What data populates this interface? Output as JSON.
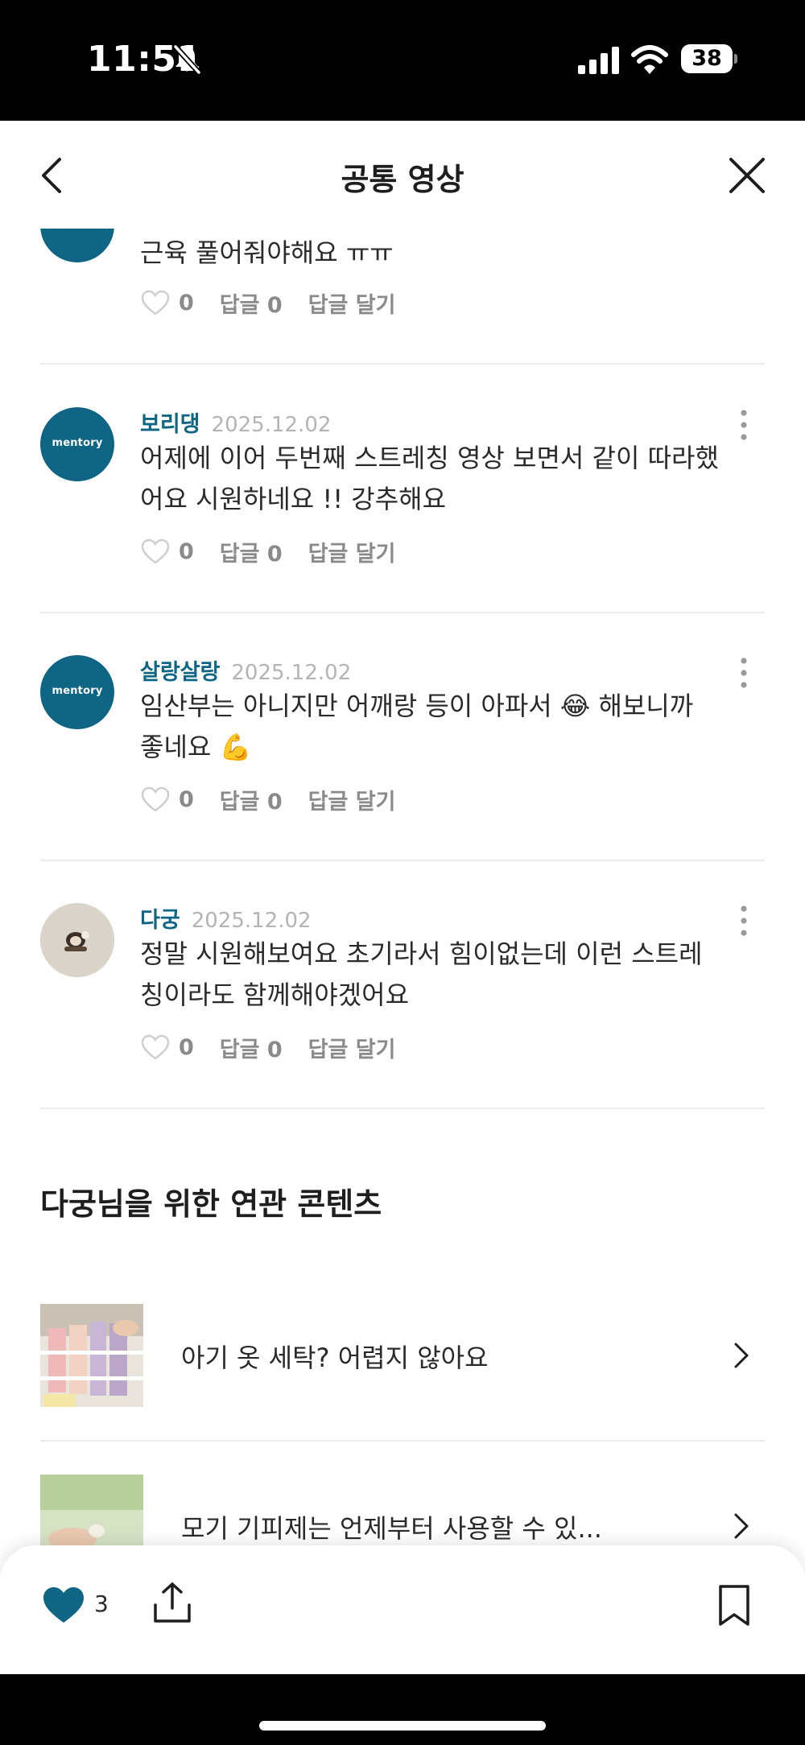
{
  "status_bar": {
    "time": "11:51",
    "battery": "38"
  },
  "header": {
    "title": "공통 영상"
  },
  "comments": [
    {
      "name": "",
      "date": "",
      "text": "근육 풀어줘야해요 ㅠㅠ",
      "likes": "0",
      "replies": "답글 0",
      "reply_label": "답글 달기"
    },
    {
      "name": "보리댕",
      "date": "2025.12.02",
      "text": "어제에 이어 두번째 스트레칭 영상 보면서 같이 따라했어요 시원하네요 !! 강추해요",
      "likes": "0",
      "replies": "답글 0",
      "reply_label": "답글 달기",
      "avatar_text": "mentory"
    },
    {
      "name": "살랑살랑",
      "date": "2025.12.02",
      "text": "임산부는 아니지만 어깨랑 등이 아파서 😂 해보니까 좋네요 💪",
      "likes": "0",
      "replies": "답글 0",
      "reply_label": "답글 달기",
      "avatar_text": "mentory"
    },
    {
      "name": "다궁",
      "date": "2025.12.02",
      "text": "정말 시원해보여요 초기라서 힘이없는데 이런 스트레칭이라도 함께해야겠어요",
      "likes": "0",
      "replies": "답글 0",
      "reply_label": "답글 달기"
    }
  ],
  "related": {
    "title": "다궁님을 위한 연관 콘텐츠",
    "items": [
      {
        "title": "아기 옷 세탁? 어렵지 않아요"
      },
      {
        "title": "모기 기피제는 언제부터 사용할 수 있..."
      }
    ]
  },
  "bottom_bar": {
    "like_count": "3"
  },
  "colors": {
    "accent": "#0e6584",
    "muted": "#8a8a8a",
    "date": "#b4b4b4"
  },
  "icons": [
    "bell-slash-icon",
    "signal-icon",
    "wifi-icon",
    "battery-icon",
    "back-icon",
    "close-icon",
    "more-vertical-icon",
    "heart-outline-icon",
    "heart-filled-icon",
    "share-icon",
    "bookmark-icon",
    "chevron-right-icon"
  ]
}
